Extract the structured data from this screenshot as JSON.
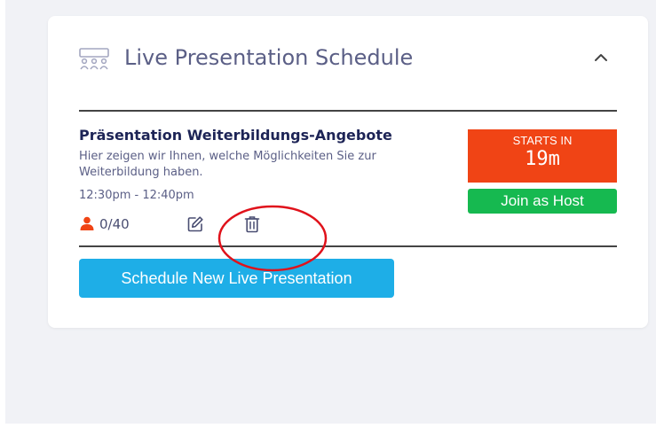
{
  "section": {
    "title": "Live Presentation Schedule",
    "header_icon": "audience-icon",
    "collapse_icon": "chevron-up-icon"
  },
  "presentation": {
    "title": "Präsentation Weiterbildungs-Angebote",
    "description": "Hier zeigen wir Ihnen, welche Möglichkeiten Sie zur Weiterbildung haben.",
    "time": "12:30pm - 12:40pm",
    "attendees": "0/40",
    "attendee_icon": "person-icon",
    "edit_icon": "edit-icon",
    "delete_icon": "trash-icon"
  },
  "countdown": {
    "label": "STARTS IN",
    "value": "19m"
  },
  "actions": {
    "join_label": "Join as Host",
    "schedule_label": "Schedule New Live Presentation"
  },
  "colors": {
    "countdown_bg": "#f04415",
    "join_bg": "#16b950",
    "schedule_bg": "#1eaee7",
    "attendee_icon": "#f04415",
    "annotation": "#e0121b"
  }
}
